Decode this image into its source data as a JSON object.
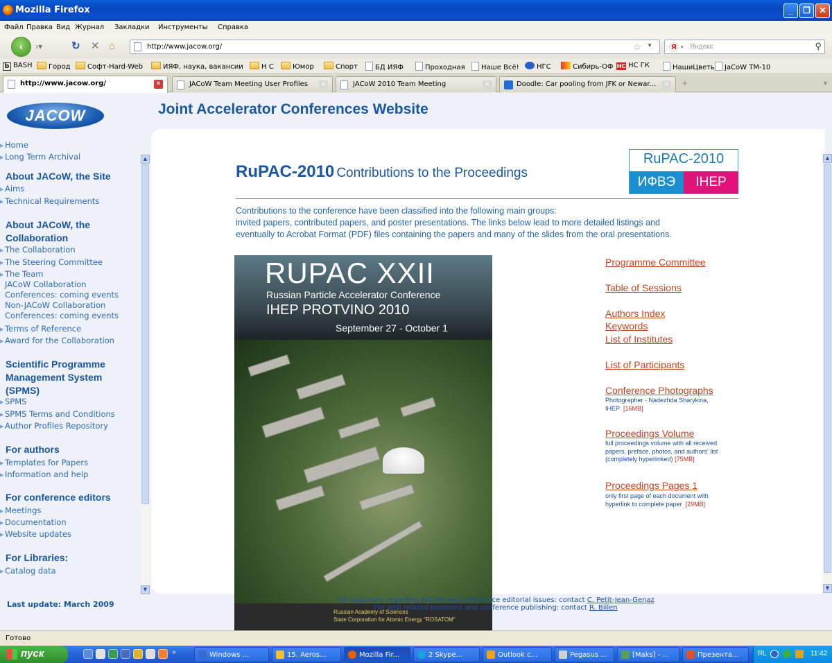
{
  "window": {
    "title": "Mozilla Firefox"
  },
  "menu": [
    "Файл",
    "Правка",
    "Вид",
    "Журнал",
    "Закладки",
    "Инструменты",
    "Справка"
  ],
  "navbar": {
    "url": "http://www.jacow.org/",
    "search_placeholder": "Яндекс"
  },
  "bookmarks": [
    {
      "label": "BASH",
      "icon": "b-icon"
    },
    {
      "label": "Город",
      "icon": "folder-icon"
    },
    {
      "label": "Софт-Hard-Web",
      "icon": "folder-icon"
    },
    {
      "label": "ИЯФ, наука, вакансии",
      "icon": "folder-icon"
    },
    {
      "label": "Н С",
      "icon": "folder-icon"
    },
    {
      "label": "Юмор",
      "icon": "folder-icon"
    },
    {
      "label": "Спорт",
      "icon": "folder-icon"
    },
    {
      "label": "БД ИЯФ",
      "icon": "page-icon"
    },
    {
      "label": "Проходная",
      "icon": "page-icon"
    },
    {
      "label": "Наше Всё!",
      "icon": "page-icon"
    },
    {
      "label": "НГС",
      "icon": "ngs-icon"
    },
    {
      "label": "Сибирь-ОФ",
      "icon": "sibir-icon"
    },
    {
      "label": "НС ГК",
      "icon": "ns-icon"
    },
    {
      "label": "НашиЦветы",
      "icon": "page-icon"
    },
    {
      "label": "JaCoW TM-10",
      "icon": "page-icon"
    }
  ],
  "tabs": [
    {
      "label": "http://www.jacow.org/",
      "active": true
    },
    {
      "label": "JACoW Team Meeting User Profiles",
      "active": false
    },
    {
      "label": "JACoW 2010 Team Meeting",
      "active": false
    },
    {
      "label": "Doodle: Car pooling from JFK or Newar...",
      "active": false
    }
  ],
  "site": {
    "logo_text": "JACOW",
    "title": "Joint Accelerator Conferences Website"
  },
  "sidebar": {
    "top_links": [
      "Home",
      "Long Term Archival"
    ],
    "sections": [
      {
        "heading": "About JACoW, the Site",
        "links": [
          "Aims",
          "Technical Requirements"
        ]
      },
      {
        "heading": "About JACoW, the Collaboration",
        "links": [
          "The Collaboration",
          "The Steering Committee",
          "The Team",
          "JACoW Collaboration Conferences: coming events",
          "Non-JACoW Collaboration Conferences: coming events",
          "Terms of Reference",
          "Award for the Collaboration"
        ]
      },
      {
        "heading": "Scientific Programme Management System (SPMS)",
        "links": [
          "SPMS",
          "SPMS Terms and Conditions",
          "Author Profiles Repository"
        ]
      },
      {
        "heading": "For authors",
        "links": [
          "Templates for Papers",
          "Information and help"
        ]
      },
      {
        "heading": "For conference editors",
        "links": [
          "Meetings",
          "Documentation",
          "Website updates"
        ]
      },
      {
        "heading": "For Libraries:",
        "links": [
          "Catalog data"
        ]
      }
    ],
    "last_update": "Last update: March 2009"
  },
  "main": {
    "title_bold": "RuPAC-2010",
    "title_rest": "Contributions to the Proceedings",
    "logo_top": "RuPAC-2010",
    "logo_left": "ИФВЭ",
    "logo_right": "IHEP",
    "intro": [
      "Contributions to the conference have been classified into the following main groups:",
      "invited papers, contributed papers, and poster presentations. The links below lead to more detailed listings and",
      "eventually to Acrobat Format (PDF) files containing the papers and many of the slides from the oral presentations."
    ],
    "poster": {
      "line1": "RUPAC   XXII",
      "line2": "Russian Particle Accelerator Conference",
      "line3": "IHEP PROTVINO 2010",
      "line4": "September 27 - October 1",
      "line5": "Russian Academy of Sciences",
      "line6": "State Corporation for Atomic Energy \"ROSATOM\""
    },
    "links": {
      "programme_committee": "Programme Committee",
      "table_of_sessions": "Table of Sessions",
      "authors_index": "Authors Index",
      "keywords": "Keywords",
      "list_of_institutes": "List of Institutes",
      "list_of_participants": "List of Participants",
      "conference_photographs": "Conference Photographs",
      "photos_note_1": "Photographer - Nadezhda Sharykina,",
      "photos_note_2": "IHEP",
      "photos_size": "[16MB]",
      "proceedings_volume": "Proceedings Volume",
      "volume_note_1": "full proceedings volume with all received",
      "volume_note_2": "papers, preface, photos, and authors' list",
      "volume_note_3": "(completely hyperlinked)",
      "volume_size": "[75MB]",
      "proceedings_pages": "Proceedings Pages 1",
      "pages_note_1": "only first page of each document with",
      "pages_note_2": "hyperlink to complete paper",
      "pages_size": "[29MB]"
    }
  },
  "footer": {
    "line1_text": "For questions regarding JACoW and conference editorial issues: contact",
    "line1_link": "C. Petit-Jean-Genaz",
    "line2_text": "For web related problems and conference publishing: contact",
    "line2_link": "R. Billen"
  },
  "status": "Готово",
  "taskbar": {
    "start": "пуск",
    "items": [
      "Windows ...",
      "15. Aeros...",
      "Mozilla Fir...",
      "2 Skype...",
      "Outlook c...",
      "Pegasus ...",
      "[Maks] - ...",
      "Презента..."
    ],
    "lang": "RL",
    "clock": "11:42"
  },
  "colors": {
    "link_blue": "#2f6bb3",
    "heading_blue": "#1a57a0",
    "link_red": "#c8431f",
    "size_red": "#d12b2b",
    "ihep_pink": "#e0137a",
    "ihep_blue": "#1a8fd0"
  }
}
